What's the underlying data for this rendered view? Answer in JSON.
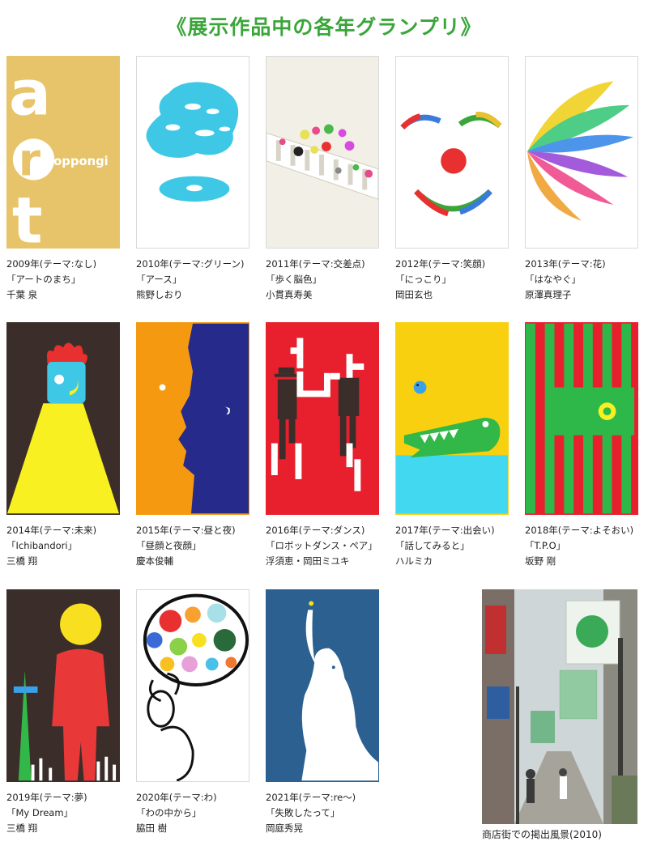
{
  "title": "《展示作品中の各年グランプリ》",
  "posters": [
    {
      "year_theme": "2009年(テーマ:なし)",
      "work": "「アートのまち」",
      "artist": "千葉 泉",
      "inner_text": "oppongi"
    },
    {
      "year_theme": "2010年(テーマ:グリーン)",
      "work": "「アース」",
      "artist": "熊野しおり"
    },
    {
      "year_theme": "2011年(テーマ:交差点)",
      "work": "「歩く脳色」",
      "artist": "小貫真寿美"
    },
    {
      "year_theme": "2012年(テーマ:笑顔)",
      "work": "「にっこり」",
      "artist": "岡田玄也"
    },
    {
      "year_theme": "2013年(テーマ:花)",
      "work": "「はなやぐ」",
      "artist": "原澤真理子"
    },
    {
      "year_theme": "2014年(テーマ:未来)",
      "work": "「Ichibandori」",
      "artist": "三橋 翔"
    },
    {
      "year_theme": "2015年(テーマ:昼と夜)",
      "work": "「昼顔と夜顔」",
      "artist": "慶本俊輔"
    },
    {
      "year_theme": "2016年(テーマ:ダンス)",
      "work": "「ロボットダンス・ペア」",
      "artist": "浮須恵・岡田ミユキ"
    },
    {
      "year_theme": "2017年(テーマ:出会い)",
      "work": "「話してみると」",
      "artist": "ハルミカ"
    },
    {
      "year_theme": "2018年(テーマ:よそおい)",
      "work": "「T.P.O」",
      "artist": "坂野 剛"
    },
    {
      "year_theme": "2019年(テーマ:夢)",
      "work": "「My Dream」",
      "artist": "三橋 翔"
    },
    {
      "year_theme": "2020年(テーマ:わ)",
      "work": "「わの中から」",
      "artist": "脇田 樹"
    },
    {
      "year_theme": "2021年(テーマ:re〜)",
      "work": "「失敗したって」",
      "artist": "岡庭秀晃"
    }
  ],
  "photo_caption": "商店街での掲出風景(2010)"
}
